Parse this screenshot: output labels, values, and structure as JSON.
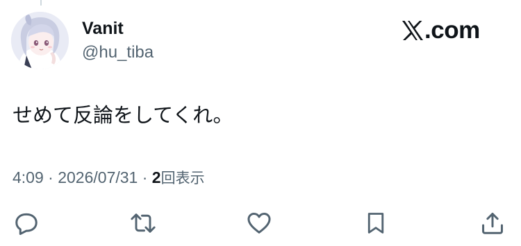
{
  "tweet": {
    "author_name": "Vanit",
    "author_handle": "@hu_tiba",
    "text": "せめて反論をしてくれ。",
    "time": "4:09",
    "separator": " · ",
    "date": "2026/07/31",
    "views_count": "2",
    "views_label": "回表示"
  },
  "brand": {
    "logo_icon": "x-logo-icon",
    "text": ".com"
  },
  "actions": [
    {
      "name": "reply",
      "icon": "reply-icon"
    },
    {
      "name": "retweet",
      "icon": "retweet-icon"
    },
    {
      "name": "like",
      "icon": "heart-icon"
    },
    {
      "name": "bookmark",
      "icon": "bookmark-icon"
    },
    {
      "name": "share",
      "icon": "share-icon"
    }
  ],
  "colors": {
    "text_primary": "#0f1419",
    "text_secondary": "#536471",
    "icon": "#536471",
    "background": "#ffffff"
  }
}
